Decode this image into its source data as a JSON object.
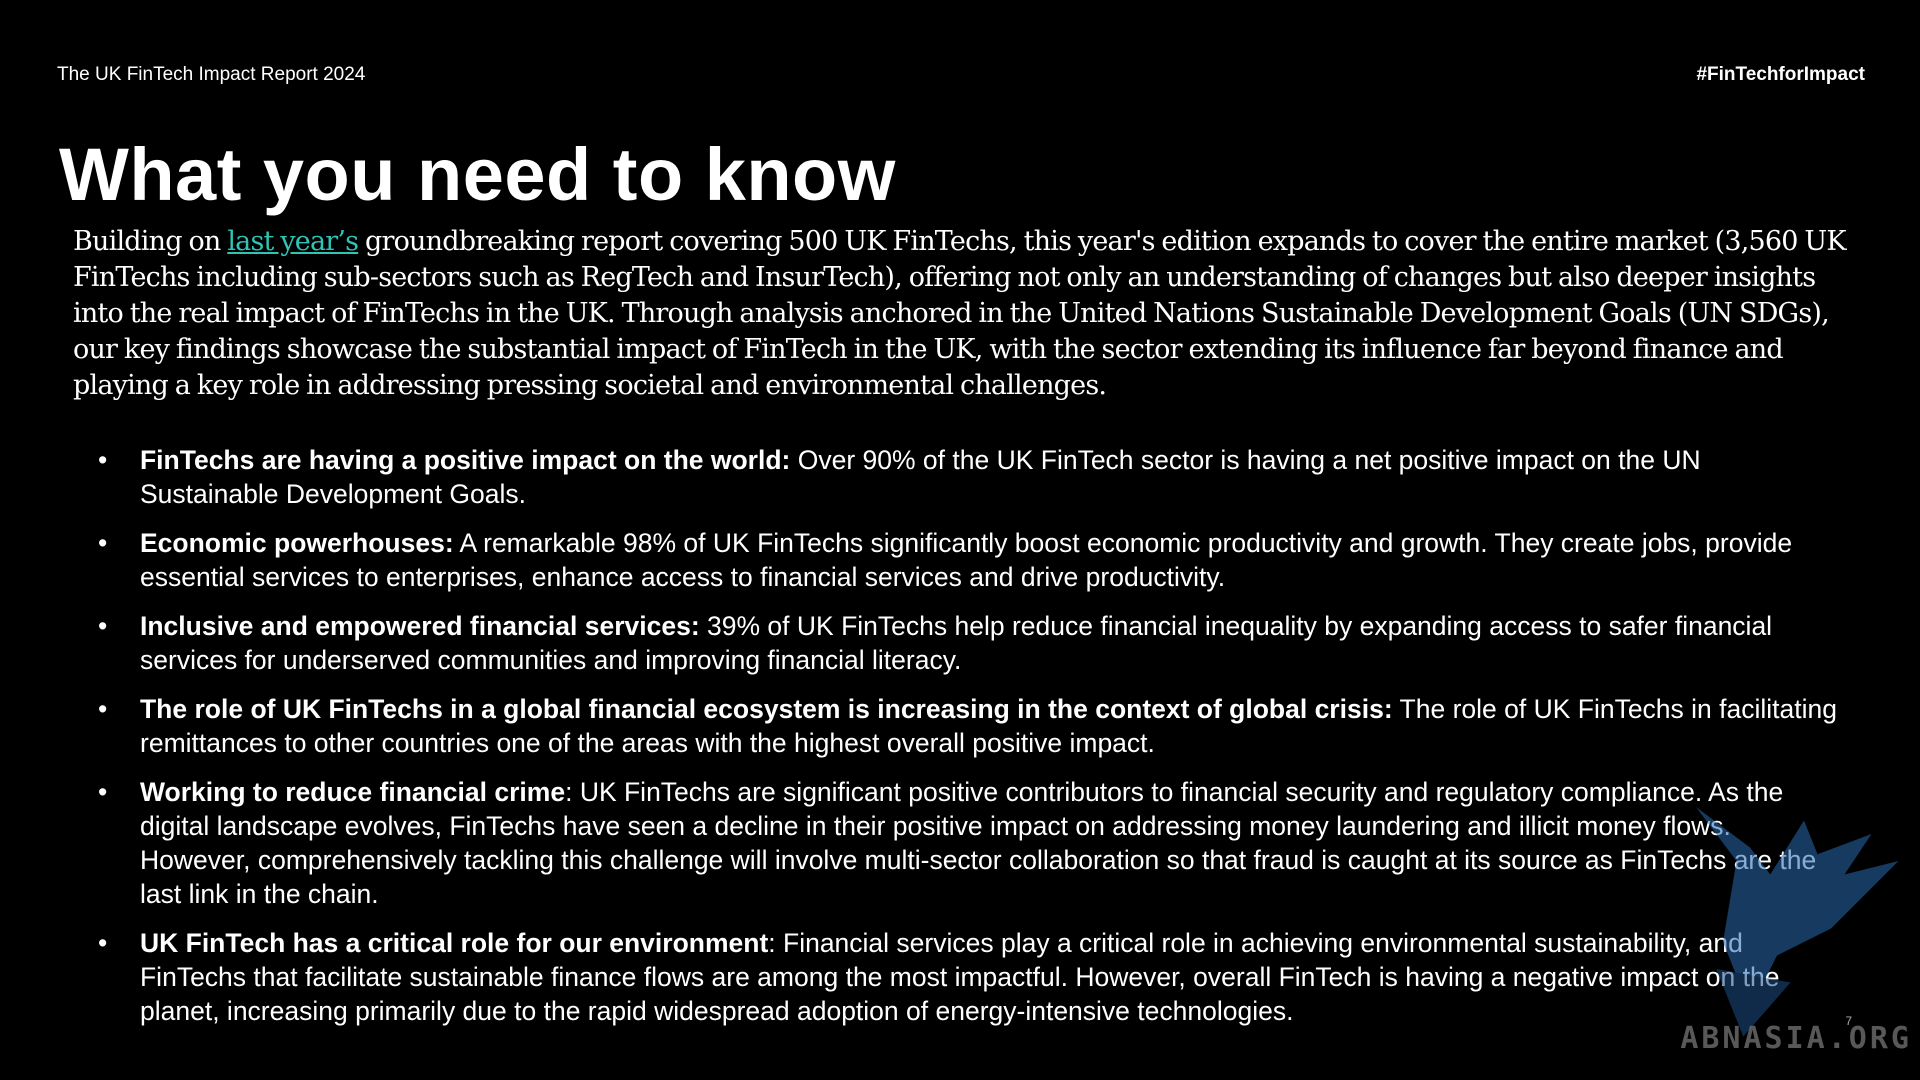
{
  "header": {
    "report_title": "The UK FinTech Impact Report 2024",
    "hashtag": "#FinTechforImpact"
  },
  "page_title": "What you need to know",
  "intro": {
    "before_link": "Building on ",
    "link_text": "last year’s",
    "after_link": " groundbreaking report covering 500 UK FinTechs, this year's edition expands to cover the entire market (3,560 UK FinTechs including sub-sectors such as RegTech and InsurTech), offering not only an understanding of changes but also deeper insights into the real impact of FinTechs in the UK. Through analysis anchored in the United Nations Sustainable Development Goals (UN SDGs), our key findings showcase the substantial impact of FinTech in the UK, with the sector extending its influence far beyond finance and playing a key role in addressing pressing societal and environmental challenges."
  },
  "findings": [
    {
      "heading": "FinTechs are having a positive impact on the world:",
      "text": " Over 90% of the UK FinTech sector is having a net positive impact on the UN Sustainable Development Goals."
    },
    {
      "heading": "Economic powerhouses:",
      "text": " A remarkable 98% of UK FinTechs significantly boost economic productivity and growth. They create jobs, provide essential services to enterprises, enhance access to financial services and drive productivity."
    },
    {
      "heading": "Inclusive and empowered financial services:",
      "text": " 39% of UK FinTechs help reduce financial inequality by expanding access to safer financial services for underserved communities and improving financial literacy."
    },
    {
      "heading": "The role of UK FinTechs in a global financial ecosystem is increasing in the context of global crisis:",
      "text": " The role of UK FinTechs in facilitating remittances to other countries one of the areas with the highest overall positive impact."
    },
    {
      "heading": "Working to reduce financial crime",
      "text": ": UK FinTechs are significant positive contributors to financial security and regulatory compliance. As the digital landscape evolves, FinTechs have seen a decline in their positive impact on addressing money laundering and illicit money flows. However, comprehensively tackling this challenge will involve multi-sector collaboration so that fraud is caught at its source as FinTechs are the last link in the chain."
    },
    {
      "heading": "UK FinTech has a critical role for our environment",
      "text": ": Financial services play a critical role in achieving environmental sustainability, and FinTechs that facilitate sustainable finance flows are among the most impactful. However, overall FinTech is having a negative impact on the planet, increasing primarily due to the rapid widespread adoption of energy-intensive technologies."
    }
  ],
  "bullet_glyph": "•",
  "watermark": {
    "text": "ABNASIA.ORG",
    "icon": "eagle-logo-icon"
  },
  "page_number": "7",
  "colors": {
    "background": "#000000",
    "text": "#ffffff",
    "link": "#2ec4b6",
    "watermark_blue": "#2b6cb0"
  }
}
